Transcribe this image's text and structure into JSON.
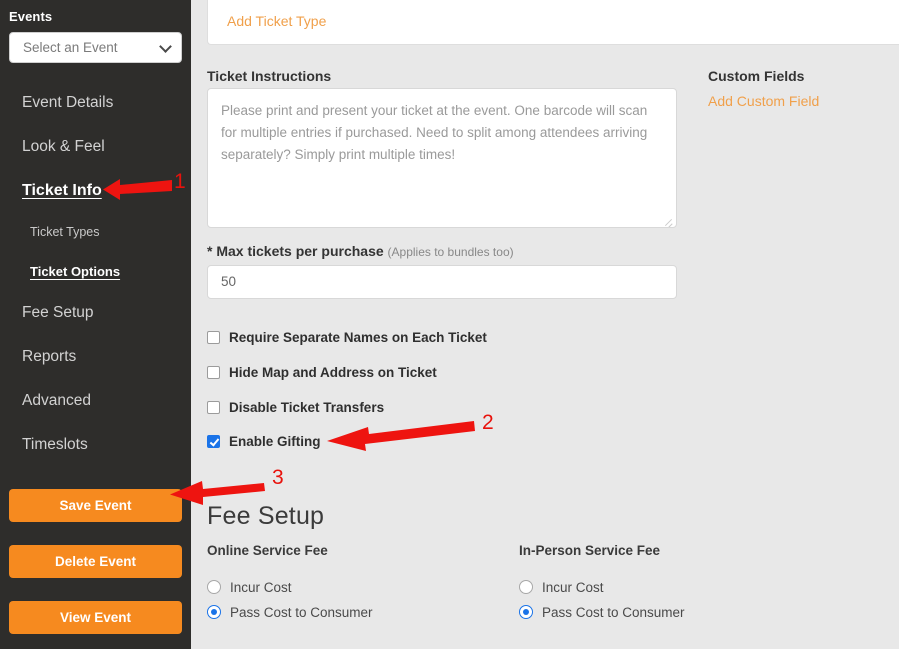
{
  "sidebar": {
    "title": "Events",
    "event_select": {
      "value": "Select an Event",
      "icon": "chevron-down-icon"
    },
    "nav_items": [
      {
        "label": "Event Details",
        "active": false
      },
      {
        "label": "Look & Feel",
        "active": false
      },
      {
        "label": "Ticket Info",
        "active": true
      }
    ],
    "sub_items": [
      {
        "label": "Ticket Types",
        "active": false
      },
      {
        "label": "Ticket Options",
        "active": true
      }
    ],
    "nav_items_2": [
      {
        "label": "Fee Setup",
        "active": false
      },
      {
        "label": "Reports",
        "active": false
      },
      {
        "label": "Advanced",
        "active": false
      },
      {
        "label": "Timeslots",
        "active": false
      }
    ],
    "buttons": {
      "save": "Save Event",
      "delete": "Delete Event",
      "view": "View Event"
    }
  },
  "main": {
    "add_ticket_type": "Add Ticket Type",
    "ticket_instructions": {
      "label": "Ticket Instructions",
      "placeholder": "Please print and present your ticket at the event. One barcode will scan for multiple entries if purchased. Need to split among attendees arriving separately? Simply print multiple times!"
    },
    "max_tickets": {
      "asterisk": "*",
      "label": "Max tickets per purchase",
      "hint": "(Applies to bundles too)",
      "value": "50"
    },
    "checkboxes": [
      {
        "label": "Require Separate Names on Each Ticket",
        "checked": false
      },
      {
        "label": "Hide Map and Address on Ticket",
        "checked": false
      },
      {
        "label": "Disable Ticket Transfers",
        "checked": false
      },
      {
        "label": "Enable Gifting",
        "checked": true
      }
    ],
    "fee_setup": {
      "title": "Fee Setup",
      "online": {
        "title": "Online Service Fee",
        "options": [
          {
            "label": "Incur Cost",
            "selected": false
          },
          {
            "label": "Pass Cost to Consumer",
            "selected": true
          }
        ]
      },
      "in_person": {
        "title": "In-Person Service Fee",
        "options": [
          {
            "label": "Incur Cost",
            "selected": false
          },
          {
            "label": "Pass Cost to Consumer",
            "selected": true
          }
        ]
      }
    }
  },
  "right_column": {
    "custom_fields_title": "Custom Fields",
    "add_custom_field": "Add Custom Field"
  },
  "annotations": [
    {
      "number": "1",
      "target": "ticket-info-nav-item"
    },
    {
      "number": "2",
      "target": "enable-gifting-checkbox"
    },
    {
      "number": "3",
      "target": "save-event-button"
    }
  ],
  "colors": {
    "sidebar_bg": "#2e2d2b",
    "accent_orange": "#f68a1f",
    "link_orange": "#f0a04b",
    "checkbox_blue": "#1a73e8",
    "annotation_red": "#e8120c",
    "page_bg": "#e8e8e8"
  }
}
